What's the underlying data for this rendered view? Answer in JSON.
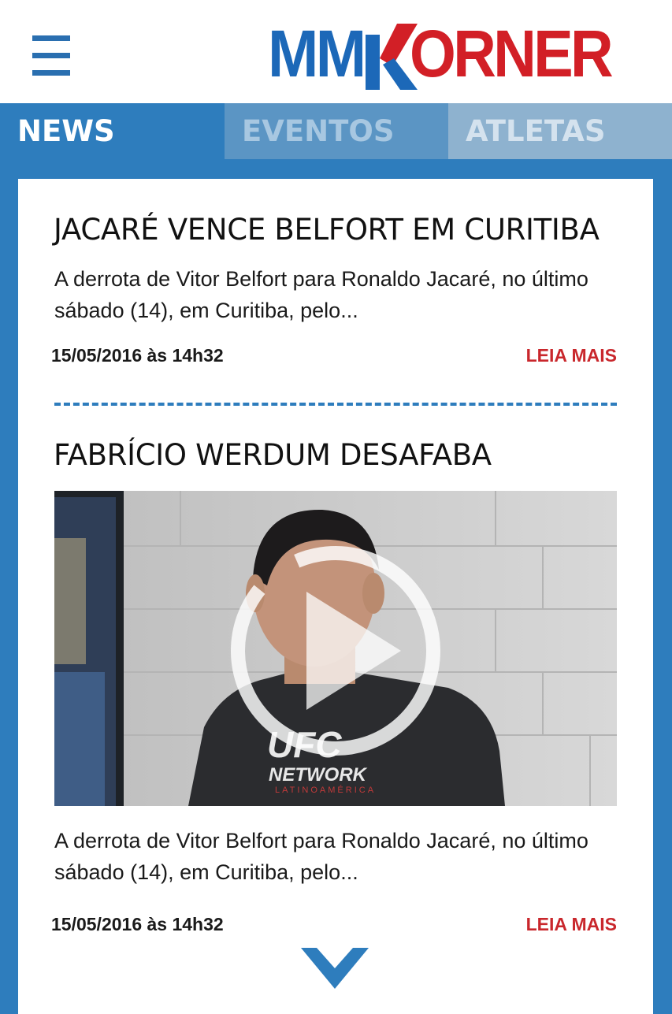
{
  "header": {
    "logo": {
      "left": "MM",
      "right": "ORNER",
      "brand_blue": "#1c68b8",
      "brand_red": "#d21f26"
    },
    "menu_icon": "hamburger-icon"
  },
  "tabs": [
    {
      "label": "NEWS",
      "active": true
    },
    {
      "label": "EVENTOS",
      "active": false
    },
    {
      "label": "ATLETAS",
      "active": false
    }
  ],
  "articles": [
    {
      "title": "JACARÉ VENCE BELFORT EM CURITIBA",
      "excerpt": "A derrota de Vitor Belfort para Ronaldo Jacaré, no último sábado (14), em Curitiba, pelo...",
      "date": "15/05/2016 às 14h32",
      "read_more": "LEIA MAIS"
    },
    {
      "title": "FABRÍCIO WERDUM DESAFABA",
      "media": {
        "type": "video",
        "play_icon": "play-circle-icon",
        "shirt_text": [
          "UFC",
          "NETWORK",
          "LATINOAMÉRICA"
        ]
      },
      "excerpt": "A derrota de Vitor Belfort para Ronaldo Jacaré, no último sábado (14), em Curitiba, pelo...",
      "date": "15/05/2016 às 14h32",
      "read_more": "LEIA MAIS"
    }
  ],
  "colors": {
    "accent": "#2e7dbd",
    "link": "#c9272c"
  },
  "scroll_icon": "chevron-down-icon"
}
